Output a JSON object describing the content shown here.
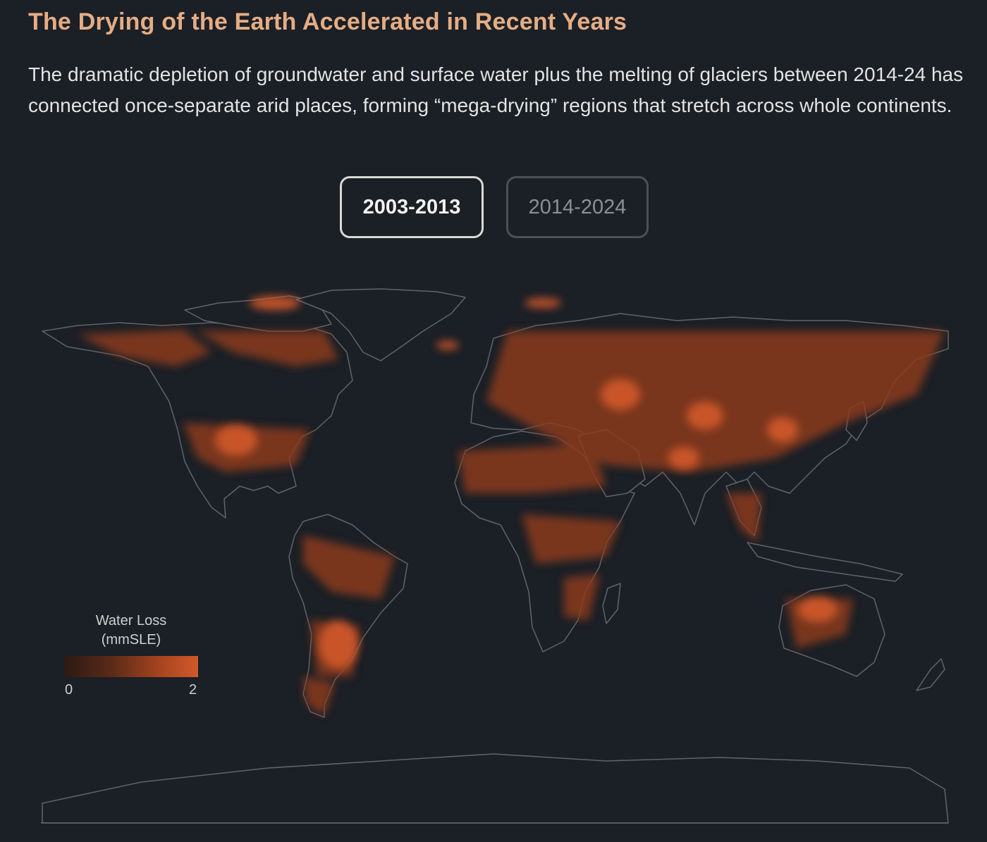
{
  "header": {
    "title": "The Drying of the Earth Accelerated in Recent Years",
    "description": "The dramatic depletion of groundwater and surface water plus the melting of glaciers between 2014-24 has connected once-separate arid places, forming “mega-drying” regions that stretch across whole continents."
  },
  "toggle": {
    "selected": "2003-2013",
    "options": [
      "2003-2013",
      "2014-2024"
    ]
  },
  "legend": {
    "title_line1": "Water Loss",
    "title_line2": "(mmSLE)",
    "min": "0",
    "max": "2",
    "color_low": "#2b1a14",
    "color_high": "#d2592a"
  },
  "colors": {
    "background": "#1b1f26",
    "land": "#1b1f26",
    "coastline": "#5f646c",
    "title": "#e5ad84"
  }
}
